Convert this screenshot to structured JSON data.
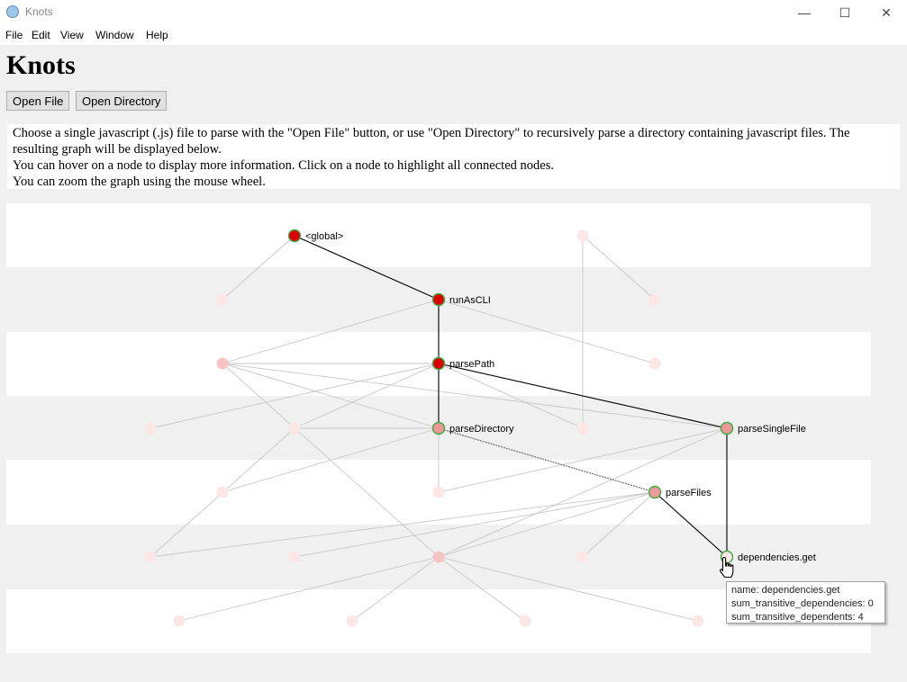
{
  "window": {
    "title": "Knots",
    "minimize_glyph": "—",
    "maximize_glyph": "☐",
    "close_glyph": "✕"
  },
  "menu": [
    "File",
    "Edit",
    "View",
    "Window",
    "Help"
  ],
  "heading": "Knots",
  "buttons": {
    "open_file": "Open File",
    "open_directory": "Open Directory"
  },
  "info": [
    "Choose a single javascript (.js) file to parse with the \"Open File\" button, or use \"Open Directory\" to recursively parse a directory containing javascript files. The resulting graph will be displayed below.",
    "You can hover on a node to display more information. Click on a node to highlight all connected nodes.",
    "You can zoom the graph using the mouse wheel."
  ],
  "graph": {
    "colors": {
      "highlight_fill": "#dd0000",
      "connected_fill": "#ee9999",
      "hovered_fill": "#fce6e6",
      "faded_fill": "#fce6e6",
      "selected_stroke": "#44aa44",
      "edge_active": "#000000",
      "edge_faded": "#c8c8c8",
      "band": "#ffffff"
    },
    "nodes": [
      {
        "id": "global",
        "label": "<global>",
        "state": "highlight"
      },
      {
        "id": "runAsCLI",
        "label": "runAsCLI",
        "state": "highlight"
      },
      {
        "id": "parsePath",
        "label": "parsePath",
        "state": "highlight"
      },
      {
        "id": "parseDirectory",
        "label": "parseDirectory",
        "state": "connected"
      },
      {
        "id": "parseSingleFile",
        "label": "parseSingleFile",
        "state": "connected"
      },
      {
        "id": "parseFiles",
        "label": "parseFiles",
        "state": "connected"
      },
      {
        "id": "depsGet",
        "label": "dependencies.get",
        "state": "hovered"
      },
      {
        "id": "f1",
        "label": "",
        "state": "faded"
      },
      {
        "id": "f2",
        "label": "",
        "state": "faded"
      },
      {
        "id": "f3",
        "label": "",
        "state": "faded"
      },
      {
        "id": "f4",
        "label": "",
        "state": "fadedDark"
      },
      {
        "id": "f5",
        "label": "",
        "state": "faded"
      },
      {
        "id": "f6",
        "label": "",
        "state": "faded"
      },
      {
        "id": "f7",
        "label": "",
        "state": "faded"
      },
      {
        "id": "f8",
        "label": "",
        "state": "faded"
      },
      {
        "id": "f9",
        "label": "",
        "state": "faded"
      },
      {
        "id": "f10",
        "label": "",
        "state": "faded"
      },
      {
        "id": "f11",
        "label": "",
        "state": "faded"
      },
      {
        "id": "f12",
        "label": "",
        "state": "faded"
      },
      {
        "id": "f13",
        "label": "",
        "state": "fadedDark"
      },
      {
        "id": "f14",
        "label": "",
        "state": "faded"
      },
      {
        "id": "f15",
        "label": "",
        "state": "faded"
      },
      {
        "id": "f16",
        "label": "",
        "state": "faded"
      },
      {
        "id": "f17",
        "label": "",
        "state": "faded"
      },
      {
        "id": "f18",
        "label": "",
        "state": "faded"
      }
    ]
  },
  "tooltip": {
    "name": "name: dependencies.get",
    "sum_transitive_dependencies": "sum_transitive_dependencies: 0",
    "sum_transitive_dependents": "sum_transitive_dependents: 4"
  }
}
